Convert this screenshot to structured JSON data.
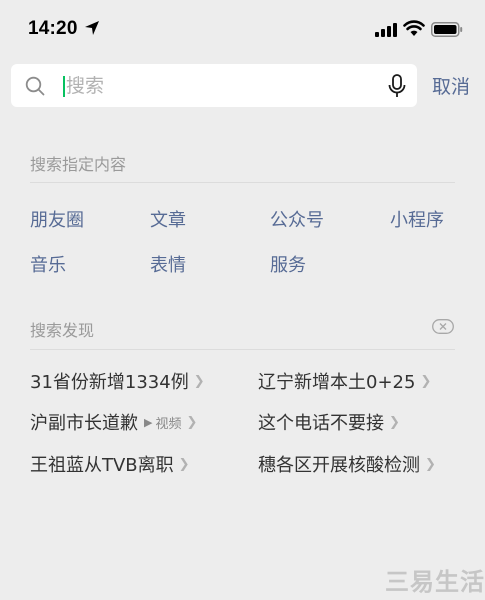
{
  "status_bar": {
    "time": "14:20"
  },
  "search": {
    "placeholder": "搜索",
    "value": ""
  },
  "cancel_label": "取消",
  "specified": {
    "title": "搜索指定内容",
    "items": [
      "朋友圈",
      "文章",
      "公众号",
      "小程序",
      "音乐",
      "表情",
      "服务"
    ]
  },
  "discover": {
    "title": "搜索发现",
    "items": [
      {
        "text": "31省份新增1334例",
        "tag": ""
      },
      {
        "text": "辽宁新增本土0+25",
        "tag": ""
      },
      {
        "text": "沪副市长道歉",
        "tag": "视频"
      },
      {
        "text": "这个电话不要接",
        "tag": ""
      },
      {
        "text": "王祖蓝从TVB离职",
        "tag": ""
      },
      {
        "text": "穗各区开展核酸检测",
        "tag": ""
      }
    ]
  },
  "watermark": "三易生活",
  "colors": {
    "accent": "#576b95",
    "caret": "#07c160",
    "background": "#ededed"
  }
}
